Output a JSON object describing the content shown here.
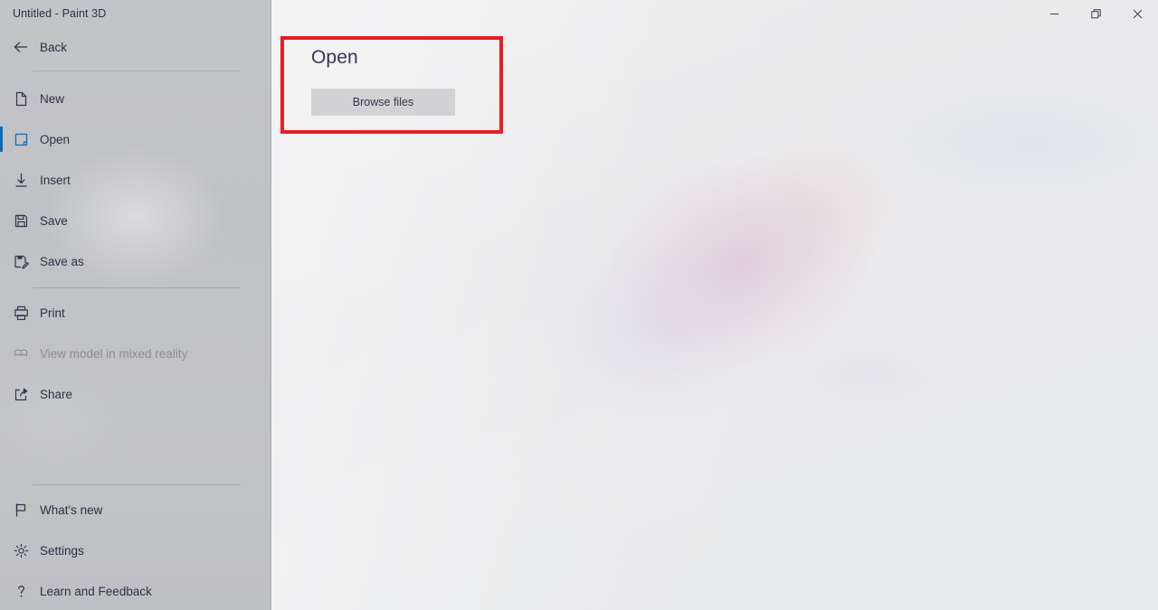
{
  "window": {
    "title": "Untitled - Paint 3D",
    "controls": [
      {
        "name": "minimize",
        "glyph": "–",
        "label": "Minimize"
      },
      {
        "name": "restore",
        "glyph": "❐",
        "label": "Restore"
      },
      {
        "name": "close",
        "glyph": "✕",
        "label": "Close"
      }
    ]
  },
  "sidebar": {
    "back": {
      "label": "Back",
      "icon": "arrow-left-icon"
    },
    "items": [
      {
        "label": "New",
        "icon": "new-document-icon",
        "selected": false,
        "disabled": false
      },
      {
        "label": "Open",
        "icon": "open-folder-icon",
        "selected": true,
        "disabled": false
      },
      {
        "label": "Insert",
        "icon": "insert-download-icon",
        "selected": false,
        "disabled": false
      },
      {
        "label": "Save",
        "icon": "save-disk-icon",
        "selected": false,
        "disabled": false
      },
      {
        "label": "Save as",
        "icon": "save-as-icon",
        "selected": false,
        "disabled": false
      },
      {
        "label": "Print",
        "icon": "printer-icon",
        "selected": false,
        "disabled": false
      },
      {
        "label": "View model in mixed reality",
        "icon": "mixed-reality-icon",
        "selected": false,
        "disabled": true
      },
      {
        "label": "Share",
        "icon": "share-icon",
        "selected": false,
        "disabled": false
      },
      {
        "label": "What's new",
        "icon": "flag-icon",
        "selected": false,
        "disabled": false
      },
      {
        "label": "Settings",
        "icon": "gear-icon",
        "selected": false,
        "disabled": false
      },
      {
        "label": "Learn and Feedback",
        "icon": "question-mark-icon",
        "selected": false,
        "disabled": false
      }
    ]
  },
  "main": {
    "title": "Open",
    "browse_button": "Browse files"
  },
  "colors": {
    "accent": "#0a6cbd",
    "highlight_box": "#ec1c24",
    "sidebar_bg": "#c1c2c5",
    "text": "#2f3046",
    "text_disabled": "#8b8c98",
    "button_bg": "#d2d2d4"
  }
}
